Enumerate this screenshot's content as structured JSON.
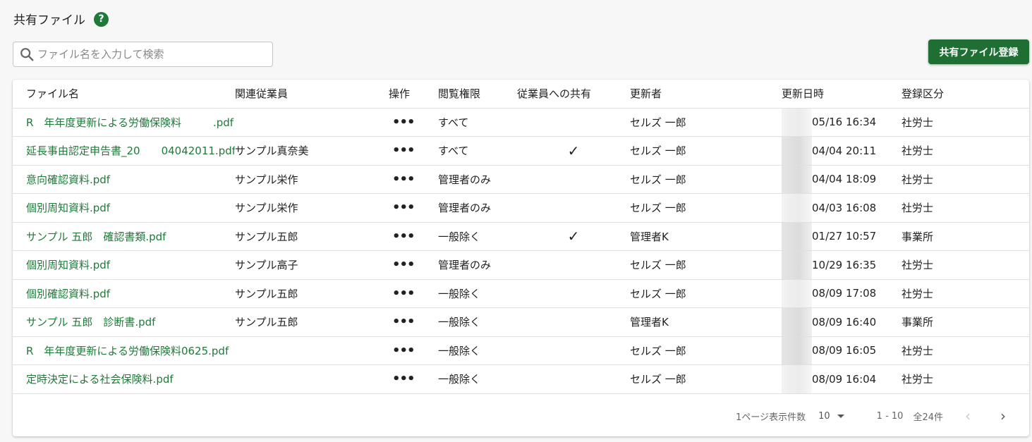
{
  "page": {
    "title": "共有ファイル",
    "help_icon": "?"
  },
  "search": {
    "placeholder": "ファイル名を入力して検索",
    "value": ""
  },
  "toolbar": {
    "register_label": "共有ファイル登録"
  },
  "table": {
    "headers": {
      "file": "ファイル名",
      "employee": "関連従業員",
      "ops": "操作",
      "permission": "閲覧権限",
      "share": "従業員への共有",
      "updater": "更新者",
      "updated_at": "更新日時",
      "category": "登録区分"
    },
    "rows": [
      {
        "file": "R　年年度更新による労働保険料　　　.pdf",
        "employee": "",
        "ops": "•••",
        "permission": "すべて",
        "share": "",
        "updater": "セルズ 一郎",
        "updated_at": "05/16 16:34",
        "category": "社労士"
      },
      {
        "file": "延長事由認定申告書_20　　04042011.pdf",
        "employee": "サンプル真奈美",
        "ops": "•••",
        "permission": "すべて",
        "share": "✓",
        "updater": "セルズ 一郎",
        "updated_at": "04/04 20:11",
        "category": "社労士"
      },
      {
        "file": "意向確認資料.pdf",
        "employee": "サンプル栄作",
        "ops": "•••",
        "permission": "管理者のみ",
        "share": "",
        "updater": "セルズ 一郎",
        "updated_at": "04/04 18:09",
        "category": "社労士"
      },
      {
        "file": "個別周知資料.pdf",
        "employee": "サンプル栄作",
        "ops": "•••",
        "permission": "管理者のみ",
        "share": "",
        "updater": "セルズ 一郎",
        "updated_at": "04/03 16:08",
        "category": "社労士"
      },
      {
        "file": "サンプル 五郎　確認書類.pdf",
        "employee": "サンプル五郎",
        "ops": "•••",
        "permission": "一般除く",
        "share": "✓",
        "updater": "管理者K",
        "updated_at": "01/27 10:57",
        "category": "事業所"
      },
      {
        "file": "個別周知資料.pdf",
        "employee": "サンプル高子",
        "ops": "•••",
        "permission": "管理者のみ",
        "share": "",
        "updater": "セルズ 一郎",
        "updated_at": "10/29 16:35",
        "category": "社労士"
      },
      {
        "file": "個別確認資料.pdf",
        "employee": "サンプル五郎",
        "ops": "•••",
        "permission": "一般除く",
        "share": "",
        "updater": "セルズ 一郎",
        "updated_at": "08/09 17:08",
        "category": "社労士"
      },
      {
        "file": "サンプル 五郎　診断書.pdf",
        "employee": "サンプル五郎",
        "ops": "•••",
        "permission": "一般除く",
        "share": "",
        "updater": "管理者K",
        "updated_at": "08/09 16:40",
        "category": "事業所"
      },
      {
        "file": "R　年年度更新による労働保険料0625.pdf",
        "employee": "",
        "ops": "•••",
        "permission": "一般除く",
        "share": "",
        "updater": "セルズ 一郎",
        "updated_at": "08/09 16:05",
        "category": "社労士"
      },
      {
        "file": "定時決定による社会保険料.pdf",
        "employee": "",
        "ops": "•••",
        "permission": "一般除く",
        "share": "",
        "updater": "セルズ 一郎",
        "updated_at": "08/09 16:04",
        "category": "社労士"
      }
    ]
  },
  "pagination": {
    "rows_per_page_label": "1ページ表示件数",
    "rows_per_page": "10",
    "range": "1 - 10",
    "total": "全24件",
    "prev_icon": "‹",
    "next_icon": "›"
  },
  "colors": {
    "accent": "#1f7a3a",
    "button": "#1f6e34"
  }
}
